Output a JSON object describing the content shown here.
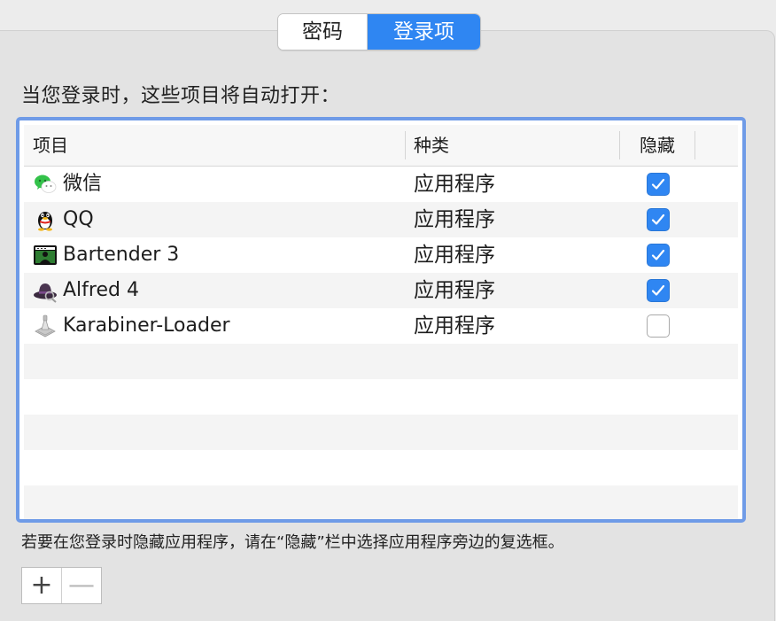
{
  "tabs": {
    "password_label": "密码",
    "login_items_label": "登录项",
    "selected": "login_items"
  },
  "intro_text": "当您登录时，这些项目将自动打开：",
  "table": {
    "headers": {
      "item": "项目",
      "kind": "种类",
      "hide": "隐藏"
    },
    "rows": [
      {
        "name": "微信",
        "kind": "应用程序",
        "hidden": true,
        "icon": "wechat-icon"
      },
      {
        "name": "QQ",
        "kind": "应用程序",
        "hidden": true,
        "icon": "qq-penguin-icon"
      },
      {
        "name": "Bartender 3",
        "kind": "应用程序",
        "hidden": true,
        "icon": "bartender-icon"
      },
      {
        "name": "Alfred 4",
        "kind": "应用程序",
        "hidden": true,
        "icon": "alfred-hat-icon"
      },
      {
        "name": "Karabiner-Loader",
        "kind": "应用程序",
        "hidden": false,
        "icon": "karabiner-app-icon"
      }
    ]
  },
  "footer_note": "若要在您登录时隐藏应用程序，请在“隐藏”栏中选择应用程序旁边的复选框。",
  "buttons": {
    "add_label": "+",
    "remove_label": "—"
  },
  "colors": {
    "accent": "#2f86f2",
    "table_focus_border": "#6f9be7"
  }
}
